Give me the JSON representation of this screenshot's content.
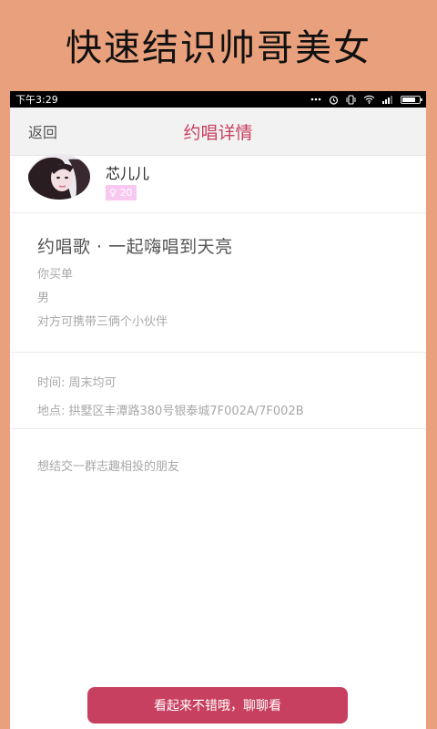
{
  "banner": {
    "text": "快速结识帅哥美女"
  },
  "status_bar": {
    "time": "下午3:29",
    "battery_level_percent": 75
  },
  "nav": {
    "back_label": "返回",
    "title": "约唱详情"
  },
  "user": {
    "name": "芯儿儿",
    "gender_symbol": "♀",
    "age": "20"
  },
  "event": {
    "title": "约唱歌 · 一起嗨唱到天亮",
    "payment": "你买单",
    "gender": "男",
    "companions": "对方可携带三俩个小伙伴",
    "time": "时间: 周末均可",
    "location": "地点: 拱墅区丰潭路380号银泰城7F002A/7F002B",
    "description": "想结交一群志趣相投的朋友"
  },
  "cta": {
    "label": "看起来不错哦，聊聊看"
  },
  "colors": {
    "accent": "#C8405F",
    "banner_bg": "#E9A07C",
    "badge_bg": "#F8C9F0"
  }
}
